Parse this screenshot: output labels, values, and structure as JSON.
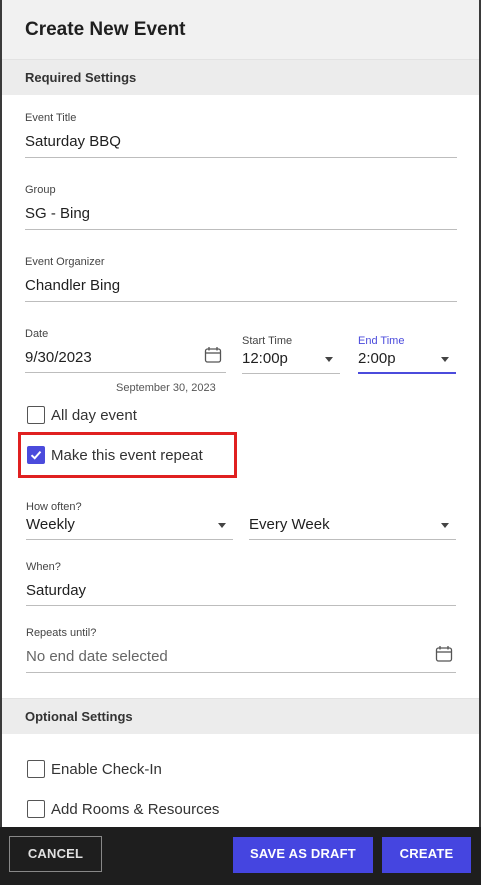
{
  "dialog": {
    "title": "Create New Event"
  },
  "required": {
    "section_label": "Required Settings",
    "event_title": {
      "label": "Event Title",
      "value": "Saturday BBQ"
    },
    "group": {
      "label": "Group",
      "value": "SG - Bing"
    },
    "organizer": {
      "label": "Event Organizer",
      "value": "Chandler Bing"
    },
    "date": {
      "label": "Date",
      "value": "9/30/2023",
      "hint": "September 30, 2023",
      "icon": "calendar-icon"
    },
    "start_time": {
      "label": "Start Time",
      "value": "12:00p"
    },
    "end_time": {
      "label": "End Time",
      "value": "2:00p",
      "accent": "#4b4bdc"
    },
    "all_day": {
      "label": "All day event",
      "checked": false
    },
    "repeat": {
      "label": "Make this event repeat",
      "checked": true
    },
    "how_often": {
      "label": "How often?",
      "value": "Weekly",
      "interval": "Every Week"
    },
    "when": {
      "label": "When?",
      "value": "Saturday"
    },
    "repeats_until": {
      "label": "Repeats until?",
      "placeholder": "No end date selected",
      "icon": "calendar-icon"
    }
  },
  "optional": {
    "section_label": "Optional Settings",
    "check_in": {
      "label": "Enable Check-In",
      "checked": false
    },
    "rooms": {
      "label": "Add Rooms & Resources",
      "checked": false
    }
  },
  "footer": {
    "cancel_label": "CANCEL",
    "draft_label": "SAVE AS DRAFT",
    "create_label": "CREATE"
  },
  "colors": {
    "accent": "#4545e0",
    "highlight": "#e02020",
    "footer_bg": "#1e1e1e"
  }
}
